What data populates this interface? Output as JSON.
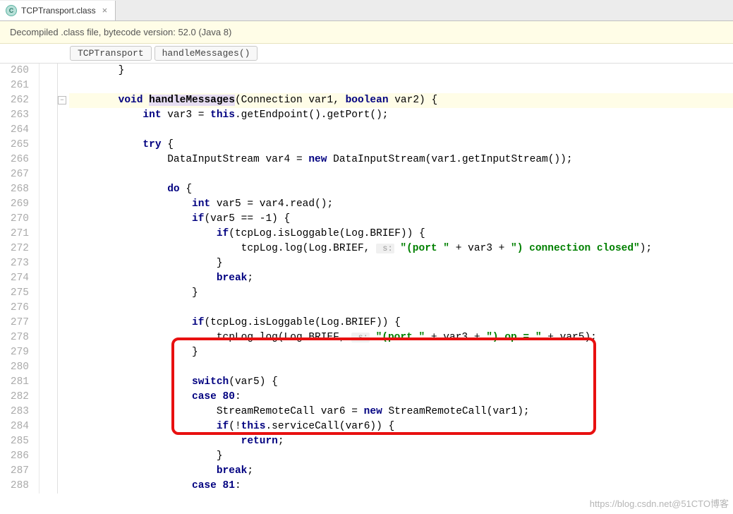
{
  "tab": {
    "icon_letter": "C",
    "label": "TCPTransport.class",
    "close": "×"
  },
  "info_bar": "Decompiled .class file, bytecode version: 52.0 (Java 8)",
  "breadcrumbs": [
    "TCPTransport",
    "handleMessages()"
  ],
  "line_numbers": [
    "260",
    "261",
    "262",
    "263",
    "264",
    "265",
    "266",
    "267",
    "268",
    "269",
    "270",
    "271",
    "272",
    "273",
    "274",
    "275",
    "276",
    "277",
    "278",
    "279",
    "280",
    "281",
    "282",
    "283",
    "284",
    "285",
    "286",
    "287",
    "288"
  ],
  "code": {
    "l260": "        }",
    "l262": {
      "pre": "        ",
      "kw1": "void ",
      "name": "handleMessages",
      "mid": "(Connection var1, ",
      "kw2": "boolean",
      "tail": " var2) {"
    },
    "l263": {
      "pre": "            ",
      "kw": "int",
      "mid": " var3 = ",
      "kw2": "this",
      "tail": ".getEndpoint().getPort();"
    },
    "l265": {
      "pre": "            ",
      "kw": "try",
      "tail": " {"
    },
    "l266": {
      "pre": "                DataInputStream var4 = ",
      "kw": "new",
      "tail": " DataInputStream(var1.getInputStream());"
    },
    "l268": {
      "pre": "                ",
      "kw": "do",
      "tail": " {"
    },
    "l269": {
      "pre": "                    ",
      "kw": "int",
      "tail": " var5 = var4.read();"
    },
    "l270": {
      "pre": "                    ",
      "kw": "if",
      "tail": "(var5 == -1) {"
    },
    "l271": {
      "pre": "                        ",
      "kw": "if",
      "tail": "(tcpLog.isLoggable(Log.BRIEF)) {"
    },
    "l272": {
      "pre": "                            tcpLog.log(Log.BRIEF, ",
      "hint": " s:",
      "s1": "\"(port \"",
      "mid": " + var3 + ",
      "s2": "\") connection closed\"",
      "tail": ");"
    },
    "l273": "                        }",
    "l274": {
      "pre": "                        ",
      "kw": "break",
      "tail": ";"
    },
    "l275": "                    }",
    "l277": {
      "pre": "                    ",
      "kw": "if",
      "tail": "(tcpLog.isLoggable(Log.BRIEF)) {"
    },
    "l278": {
      "pre": "                        tcpLog.log(Log.BRIEF, ",
      "hint": " s:",
      "s1": "\"(port \"",
      "mid": " + var3 + ",
      "s2": "\") op = \"",
      "tail": " + var5);"
    },
    "l279": "                    }",
    "l281": {
      "pre": "                    ",
      "kw": "switch",
      "tail": "(var5) {"
    },
    "l282": {
      "pre": "                    ",
      "kw": "case ",
      "num": "80",
      "tail": ":"
    },
    "l283": {
      "pre": "                        StreamRemoteCall var6 = ",
      "kw": "new",
      "tail": " StreamRemoteCall(var1);"
    },
    "l284": {
      "pre": "                        ",
      "kw": "if",
      "mid": "(!",
      "kw2": "this",
      "tail": ".serviceCall(var6)) {"
    },
    "l285": {
      "pre": "                            ",
      "kw": "return",
      "tail": ";"
    },
    "l286": "                        }",
    "l287": {
      "pre": "                        ",
      "kw": "break",
      "tail": ";"
    },
    "l288": {
      "pre": "                    ",
      "kw": "case ",
      "num": "81",
      "tail": ":"
    }
  },
  "watermark": "https://blog.csdn.net@51CTO博客"
}
